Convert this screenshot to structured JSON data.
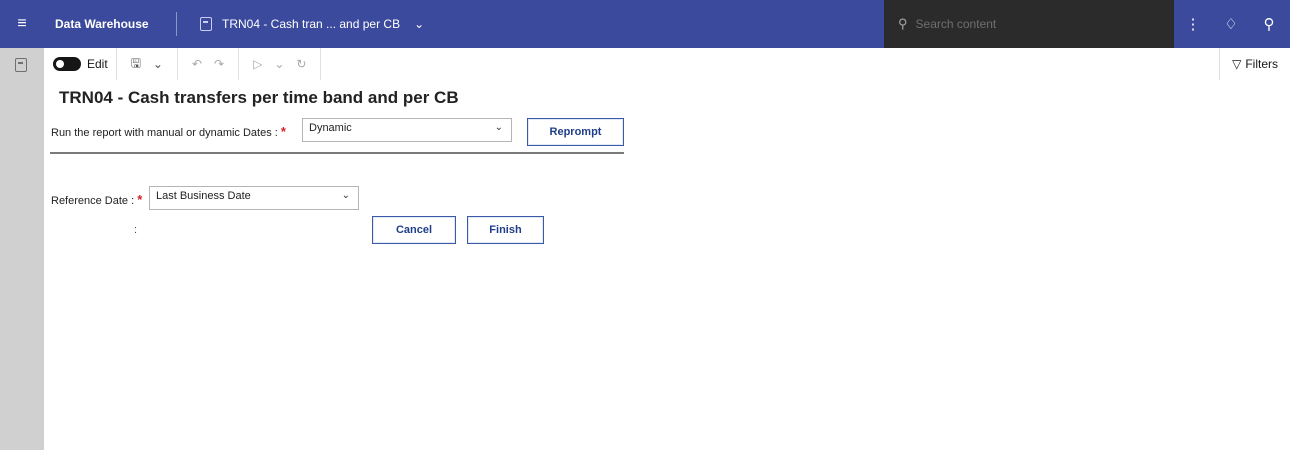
{
  "topbar": {
    "app_title": "Data Warehouse",
    "report_tab": "TRN04 - Cash tran ... and per CB",
    "search_placeholder": "Search content",
    "icons": [
      "menu-icon",
      "overflow-icon",
      "notification-icon",
      "user-icon"
    ]
  },
  "toolbar": {
    "edit_label": "Edit",
    "filters_label": "Filters"
  },
  "report": {
    "title": "TRN04 - Cash transfers per time band and per CB",
    "prompt1_label": "Run the report with manual or dynamic Dates : ",
    "prompt1_required": "*",
    "prompt1_value": "Dynamic",
    "reprompt_label": "Reprompt",
    "prompt2_label": "Reference Date : ",
    "prompt2_required": "*",
    "prompt2_value": "Last Business Date",
    "colon": ":",
    "cancel_label": "Cancel",
    "finish_label": "Finish"
  }
}
